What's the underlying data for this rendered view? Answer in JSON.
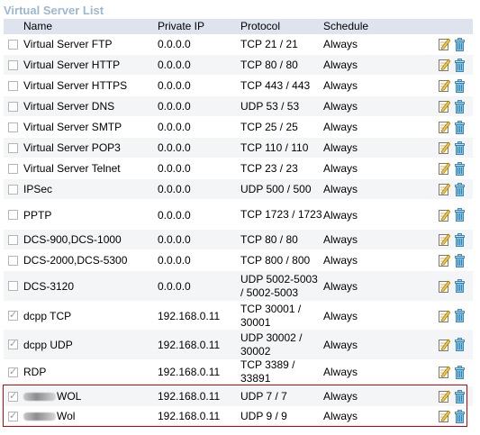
{
  "title": "Virtual Server List",
  "headers": {
    "name": "Name",
    "ip": "Private IP",
    "protocol": "Protocol",
    "schedule": "Schedule"
  },
  "rows": [
    {
      "name": "Virtual Server FTP",
      "ip": "0.0.0.0",
      "protocol": "TCP 21 / 21",
      "schedule": "Always",
      "checked": false
    },
    {
      "name": "Virtual Server HTTP",
      "ip": "0.0.0.0",
      "protocol": "TCP 80 / 80",
      "schedule": "Always",
      "checked": false
    },
    {
      "name": "Virtual Server HTTPS",
      "ip": "0.0.0.0",
      "protocol": "TCP 443 / 443",
      "schedule": "Always",
      "checked": false
    },
    {
      "name": "Virtual Server DNS",
      "ip": "0.0.0.0",
      "protocol": "UDP 53 / 53",
      "schedule": "Always",
      "checked": false
    },
    {
      "name": "Virtual Server SMTP",
      "ip": "0.0.0.0",
      "protocol": "TCP 25 / 25",
      "schedule": "Always",
      "checked": false
    },
    {
      "name": "Virtual Server POP3",
      "ip": "0.0.0.0",
      "protocol": "TCP 110 / 110",
      "schedule": "Always",
      "checked": false
    },
    {
      "name": "Virtual Server Telnet",
      "ip": "0.0.0.0",
      "protocol": "TCP 23 / 23",
      "schedule": "Always",
      "checked": false
    },
    {
      "name": "IPSec",
      "ip": "0.0.0.0",
      "protocol": "UDP 500 / 500",
      "schedule": "Always",
      "checked": false
    },
    {
      "name": "PPTP",
      "ip": "0.0.0.0",
      "protocol": "TCP 1723 / 1723",
      "schedule": "Always",
      "checked": false
    },
    {
      "name": "DCS-900,DCS-1000",
      "ip": "0.0.0.0",
      "protocol": "TCP 80 / 80",
      "schedule": "Always",
      "checked": false
    },
    {
      "name": "DCS-2000,DCS-5300",
      "ip": "0.0.0.0",
      "protocol": "TCP 800 / 800",
      "schedule": "Always",
      "checked": false
    },
    {
      "name": "DCS-3120",
      "ip": "0.0.0.0",
      "protocol": "UDP 5002-5003 / 5002-5003",
      "schedule": "Always",
      "checked": false
    },
    {
      "name": "dcpp TCP",
      "ip": "192.168.0.11",
      "protocol": "TCP 30001 / 30001",
      "schedule": "Always",
      "checked": true
    },
    {
      "name": "dcpp UDP",
      "ip": "192.168.0.11",
      "protocol": "UDP 30002 / 30002",
      "schedule": "Always",
      "checked": true
    },
    {
      "name": "RDP",
      "ip": "192.168.0.11",
      "protocol": "TCP 3389 / 33891",
      "schedule": "Always",
      "checked": true
    },
    {
      "name": "WOL",
      "ip": "192.168.0.11",
      "protocol": "UDP 7 / 7",
      "schedule": "Always",
      "checked": true,
      "redacted": true
    },
    {
      "name": "Wol",
      "ip": "192.168.0.11",
      "protocol": "UDP 9 / 9",
      "schedule": "Always",
      "checked": true,
      "redacted": true
    }
  ],
  "icons": {
    "edit": "edit-icon",
    "delete": "trash-icon"
  }
}
